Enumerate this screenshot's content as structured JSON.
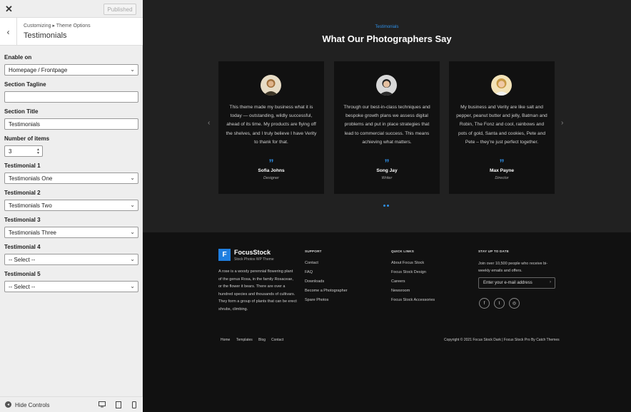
{
  "sidebar": {
    "close_symbol": "✕",
    "published_label": "Published",
    "back_symbol": "‹",
    "breadcrumb": "Customizing ▸ Theme Options",
    "panel_title": "Testimonials",
    "controls": [
      {
        "label": "Enable on",
        "type": "select",
        "value": "Homepage / Frontpage"
      },
      {
        "label": "Section Tagline",
        "type": "text",
        "value": ""
      },
      {
        "label": "Section Title",
        "type": "text",
        "value": "Testimonials"
      },
      {
        "label": "Number of items",
        "type": "number",
        "value": "3"
      },
      {
        "label": "Testimonial 1",
        "type": "select",
        "value": "Testimonials One"
      },
      {
        "label": "Testimonial 2",
        "type": "select",
        "value": "Testimonials Two"
      },
      {
        "label": "Testimonial 3",
        "type": "select",
        "value": "Testimonials Three"
      },
      {
        "label": "Testimonial 4",
        "type": "select",
        "value": "-- Select --"
      },
      {
        "label": "Testimonial 5",
        "type": "select",
        "value": "-- Select --"
      }
    ],
    "hide_controls_label": "Hide Controls"
  },
  "preview": {
    "testimonials": {
      "eyebrow": "Testimonials",
      "title": "What Our Photographers Say",
      "quote_symbol": "”",
      "prev_symbol": "‹",
      "next_symbol": "›",
      "items": [
        {
          "text": "This theme made my business what it is today — outstanding, wildly successful, ahead of its time. My products are flying off the shelves, and I truly believe I have Verity to thank for that.",
          "name": "Sofia Johns",
          "role": "Designer"
        },
        {
          "text": "Through our best-in-class techniques and bespoke growth plans we assess digital problems and put in place strategies that lead to commercial success. This means achieving what matters.",
          "name": "Song Jay",
          "role": "Writer"
        },
        {
          "text": "My business and Verity are like salt and pepper, peanut butter and jelly, Batman and Robin, The Fonz and cool, rainbows and pots of gold, Santa and cookies, Pete and Pete – they’re just perfect together.",
          "name": "Max Payne",
          "role": "Director"
        }
      ]
    },
    "footer": {
      "logo_letter": "F",
      "brand_name": "FocusStock",
      "brand_tagline": "Stock Photos WP Theme",
      "about": "A rose is a woody perennial flowering plant of the genus Rosa, in the family Rosaceae, or the flower it bears. There are over a hundred species and thousands of cultivars. They form a group of plants that can be erect shrubs, climbing.",
      "support_head": "SUPPORT",
      "support_links": [
        "Contact",
        "FAQ",
        "Downloads",
        "Become a Photographer",
        "Spare Photos"
      ],
      "quick_head": "QUICK LINKS",
      "quick_links": [
        "About Focus Stock",
        "Focus Stock Design",
        "Careers",
        "Newsroom",
        "Focus Stock Accessories"
      ],
      "newsletter_head": "STAY UP TO DATE",
      "newsletter_text": "Join over 10,500 people who receive bi-weekly emails and offers.",
      "email_placeholder": "Enter your e-mail address",
      "email_go": "›",
      "social": [
        "f",
        "t",
        "◎"
      ],
      "bottom_nav": [
        "Home",
        "Templates",
        "Blog",
        "Contact"
      ],
      "copyright": "Copyright © 2021 Focus Stock Dark | Focus Stock Pro By Catch Themes"
    }
  },
  "colors": {
    "accent": "#2e8fe6",
    "card_bg": "#111111",
    "section_bg": "#212121"
  }
}
